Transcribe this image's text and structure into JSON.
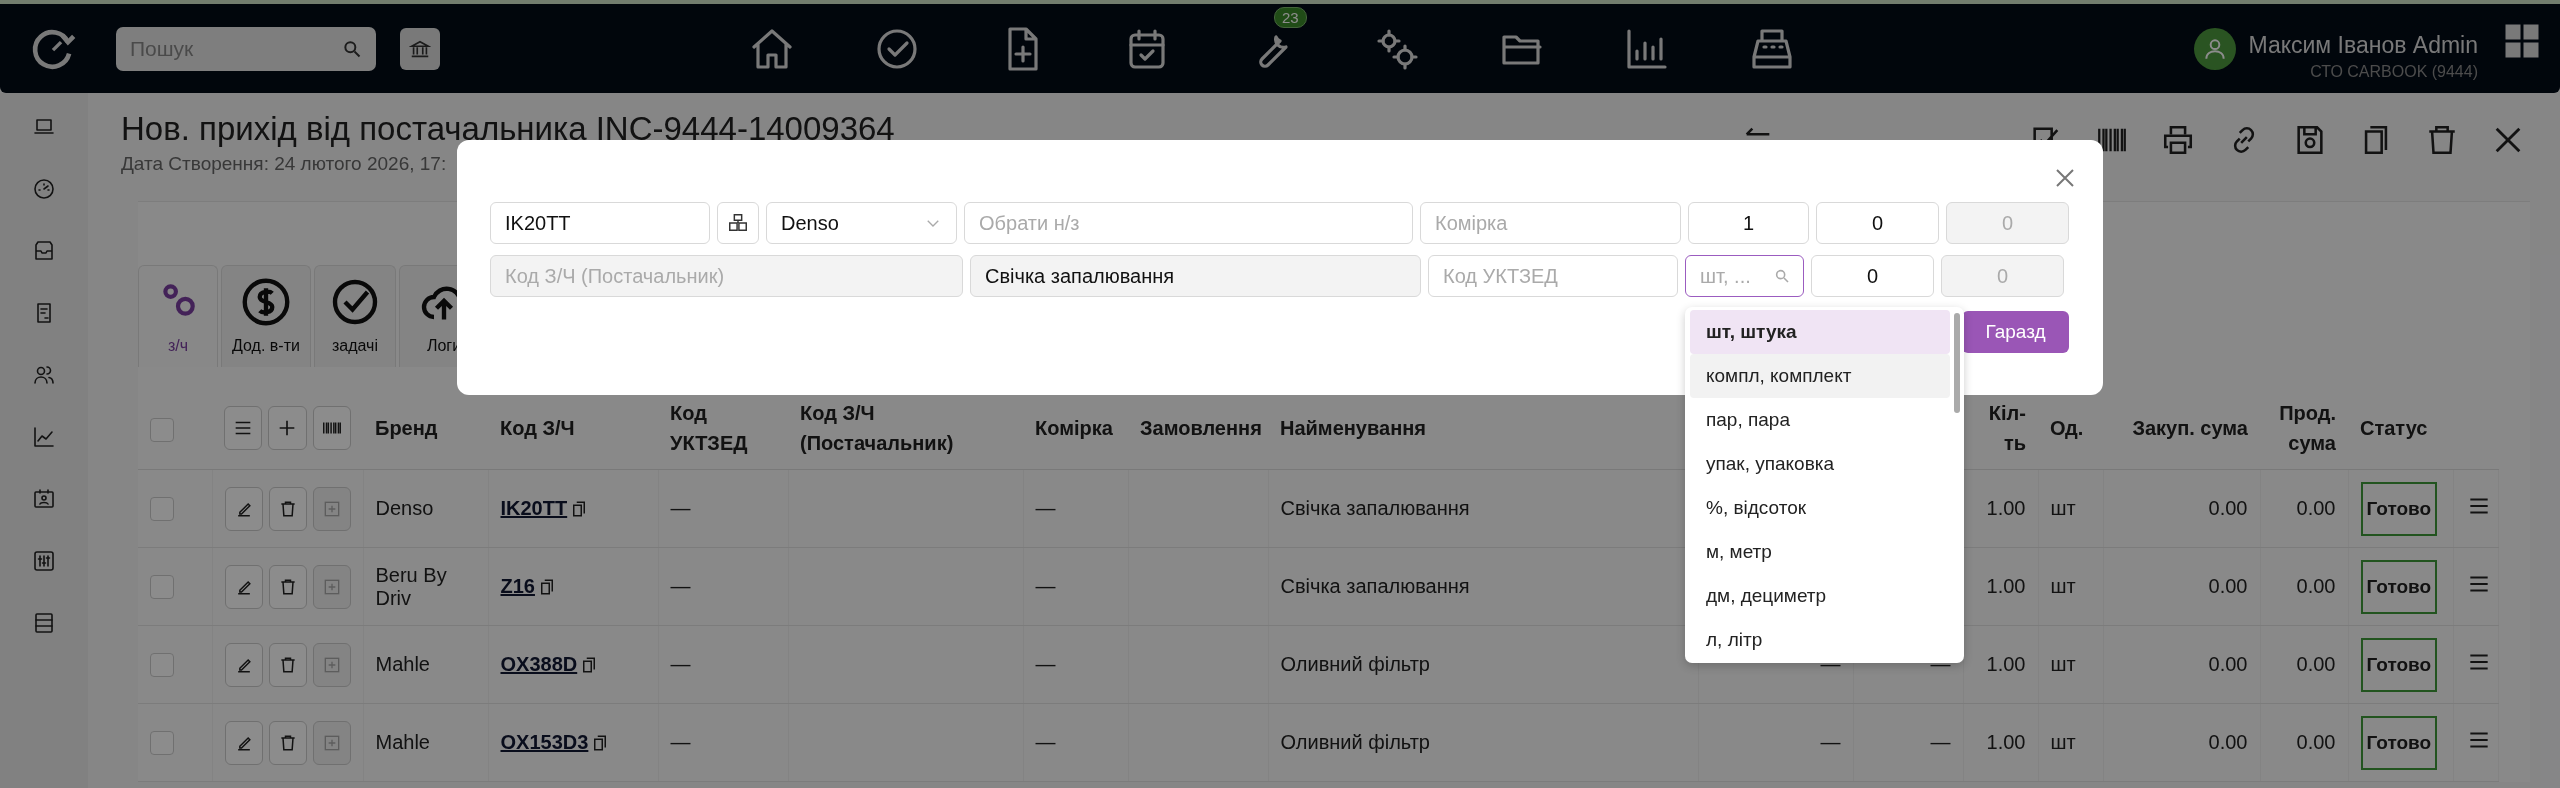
{
  "top_bar": {
    "search": {
      "placeholder": "Пошук"
    },
    "nav_badge": "23",
    "user": {
      "name": "Максим Іванов Admin",
      "company": "СТО CARBOOK (9444)"
    }
  },
  "page": {
    "title": "Нов. прихід від постачальника INC-9444-14009364",
    "subtitle": "Дата Створення: 24 лютого 2026, 17:"
  },
  "tabs": [
    {
      "label": "з/ч",
      "selected": true
    },
    {
      "label": "Дод. в-ти",
      "selected": false
    },
    {
      "label": "задачі",
      "selected": false
    },
    {
      "label": "Логи",
      "selected": false
    }
  ],
  "table": {
    "all_checked": false,
    "columns": [
      "Бренд",
      "Код З/Ч",
      "Код УКТЗЕД",
      "Код З/Ч (Постачальник)",
      "Комірка",
      "Замовлення",
      "Найменування",
      "",
      "",
      "Кіл-ть",
      "Од.",
      "Закуп. сума",
      "Прод. сума",
      "Статус"
    ],
    "rows": [
      {
        "checked": false,
        "brand": "Denso",
        "code": "IK20TT",
        "uktzed": "—",
        "cell": "—",
        "name": "Свічка запалювання",
        "qty": "1.00",
        "unit": "шт",
        "purchase_sum": "0.00",
        "sale_sum": "0.00",
        "status": "Готово"
      },
      {
        "checked": false,
        "brand": "Beru By Driv",
        "code": "Z16",
        "uktzed": "—",
        "cell": "—",
        "name": "Свічка запалювання",
        "qty": "1.00",
        "unit": "шт",
        "purchase_sum": "0.00",
        "sale_sum": "0.00",
        "status": "Готово"
      },
      {
        "checked": false,
        "brand": "Mahle",
        "code": "OX388D",
        "uktzed": "—",
        "cell": "—",
        "name": "Оливний фільтр",
        "column_9": "—",
        "column_10": "—",
        "qty": "1.00",
        "unit": "шт",
        "purchase_sum": "0.00",
        "sale_sum": "0.00",
        "status": "Готово"
      },
      {
        "checked": false,
        "brand": "Mahle",
        "code": "OX153D3",
        "uktzed": "—",
        "cell": "—",
        "name": "Оливний фільтр",
        "column_9": "—",
        "column_10": "—",
        "qty": "1.00",
        "unit": "шт",
        "purchase_sum": "0.00",
        "sale_sum": "0.00",
        "status": "Готово"
      }
    ]
  },
  "modal": {
    "fields": [
      {
        "kind": "text",
        "value": "IK20TT",
        "disabled": false,
        "focused": false
      },
      {
        "kind": "icon-button"
      },
      {
        "kind": "select",
        "value": "Denso",
        "disabled": false,
        "focused": false
      },
      {
        "kind": "text",
        "placeholder": "Обрати н/з",
        "disabled": false,
        "focused": false
      },
      {
        "kind": "text",
        "placeholder": "Комірка",
        "disabled": false,
        "focused": false
      },
      {
        "kind": "number",
        "value": "1",
        "disabled": false,
        "focused": false
      },
      {
        "kind": "number",
        "value": "0",
        "disabled": false,
        "focused": false
      },
      {
        "kind": "number",
        "value": "0",
        "disabled": true,
        "focused": false
      },
      {
        "kind": "text",
        "placeholder": "Код З/Ч (Постачальник)",
        "disabled": true,
        "focused": false
      },
      {
        "kind": "text",
        "value": "Свічка запалювання",
        "disabled": true,
        "focused": false
      },
      {
        "kind": "text",
        "placeholder": "Код УКТЗЕД",
        "disabled": false,
        "focused": false
      },
      {
        "kind": "search",
        "placeholder": "шт, ...",
        "disabled": false,
        "focused": true
      },
      {
        "kind": "number",
        "value": "0",
        "disabled": false,
        "focused": false
      },
      {
        "kind": "number",
        "value": "0",
        "disabled": true,
        "focused": false
      }
    ],
    "ok_button": "Гаразд"
  },
  "unit_dropdown": {
    "items": [
      {
        "label": "шт, штука",
        "selected": true,
        "hovered": false
      },
      {
        "label": "компл, комплект",
        "selected": false,
        "hovered": true
      },
      {
        "label": "пар, пара",
        "selected": false,
        "hovered": false
      },
      {
        "label": "упак, упаковка",
        "selected": false,
        "hovered": false
      },
      {
        "label": "%, відсоток",
        "selected": false,
        "hovered": false
      },
      {
        "label": "м, метр",
        "selected": false,
        "hovered": false
      },
      {
        "label": "дм, дециметр",
        "selected": false,
        "hovered": false
      },
      {
        "label": "л, літр",
        "selected": false,
        "hovered": false
      }
    ]
  }
}
